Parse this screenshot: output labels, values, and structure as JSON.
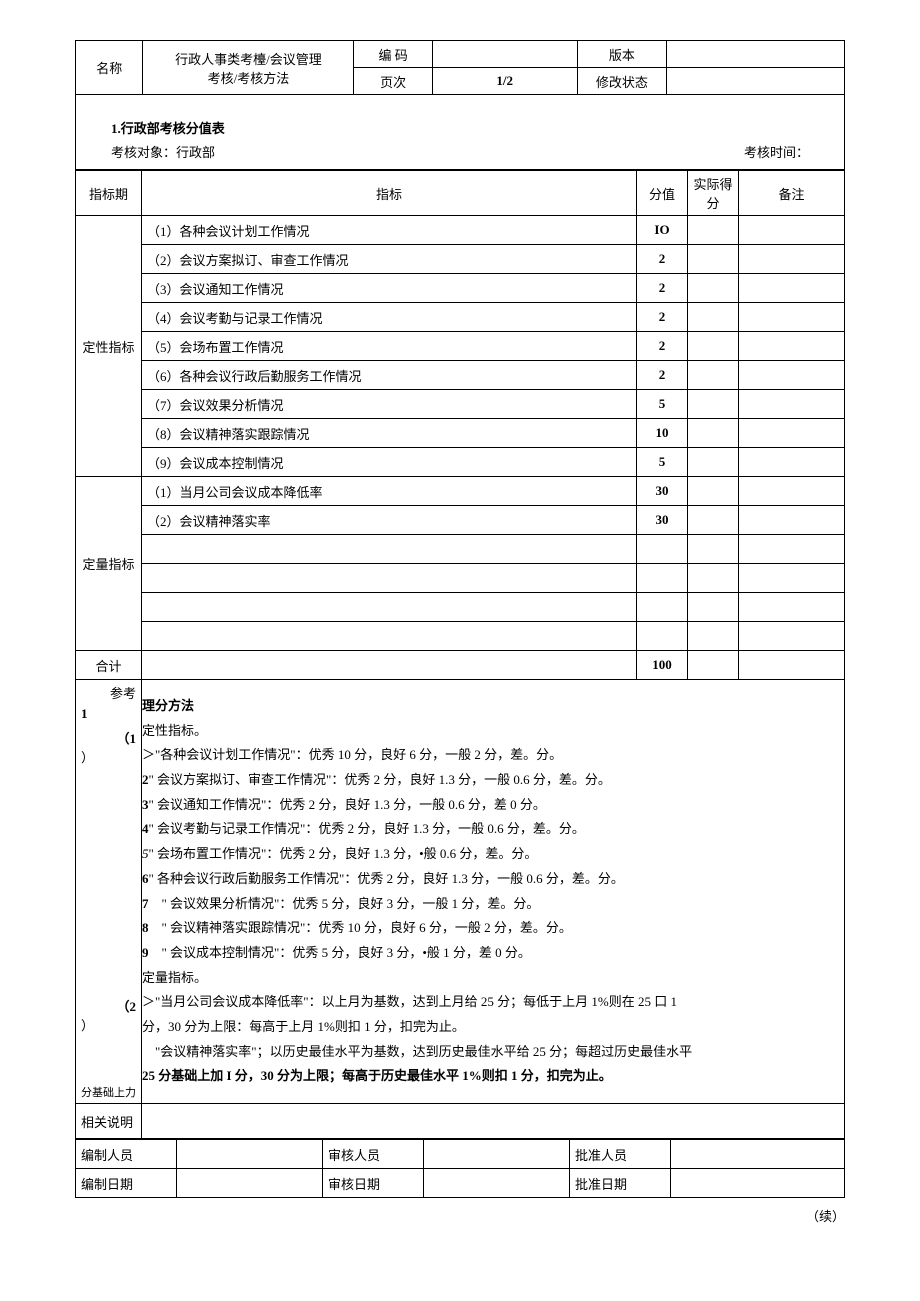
{
  "header": {
    "name_label": "名称",
    "doc_name_line1": "行政人事类考檯/会议管理",
    "doc_name_line2": "考核/考核方法",
    "code_label": "编 码",
    "code_value": "",
    "version_label": "版本",
    "version_value": "",
    "page_label": "页次",
    "page_value": "1/2",
    "mod_label": "修改状态",
    "mod_value": ""
  },
  "section": {
    "title": "1.行政部考核分值表",
    "target": "考核对象：行政部",
    "time": "考核时间："
  },
  "table_head": {
    "period": "指标期",
    "indicator": "指标",
    "score": "分值",
    "actual": "实际得分",
    "remark": "备注"
  },
  "qual_label": "定性指标",
  "qual_items": [
    {
      "no": "（1）",
      "text": "各种会议计划工作情况",
      "score": "IO"
    },
    {
      "no": "（2）",
      "text": "会议方案拟订、审查工作情况",
      "score": "2"
    },
    {
      "no": "（3）",
      "text": "会议通知工作情况",
      "score": "2"
    },
    {
      "no": "（4）",
      "text": "会议考勤与记录工作情况",
      "score": "2"
    },
    {
      "no": "（5）",
      "text": "会场布置工作情况",
      "score": "2"
    },
    {
      "no": "（6）",
      "text": "各种会议行政后勤服务工作情况",
      "score": "2"
    },
    {
      "no": "（7）",
      "text": "会议效果分析情况",
      "score": "5"
    },
    {
      "no": "（8）",
      "text": "会议精神落实跟踪情况",
      "score": "10"
    },
    {
      "no": "（9）",
      "text": "会议成本控制情况",
      "score": "5"
    }
  ],
  "quant_label": "定量指标",
  "quant_items": [
    {
      "no": "（1）",
      "text": "当月公司会议成本降低率",
      "score": "30"
    },
    {
      "no": "（2）",
      "text": "会议精神落实率",
      "score": "30"
    }
  ],
  "total_label": "合计",
  "total_score": "100",
  "ref_label": "参考",
  "basis_label": "分基础上力",
  "method": {
    "title": "理分方法",
    "m1": "（1",
    "m1b": "）",
    "qual_head": "定性指标。",
    "lines": [
      {
        "n": "",
        "t": "＞\"各种会议计划工作情况\"：优秀 10 分，良好 6 分，一般 2 分，差。分。"
      },
      {
        "n": "2",
        "t": "\" 会议方案拟订、审查工作情况\"：优秀 2 分，良好 1.3 分，一般 0.6 分，差。分。"
      },
      {
        "n": "3",
        "t": "\" 会议通知工作情况\"：优秀 2 分，良好 1.3 分，一般 0.6 分，差 0 分。"
      },
      {
        "n": "4",
        "t": "\" 会议考勤与记录工作情况\"：优秀 2 分，良好 1.3 分，一般 0.6 分，差。分。"
      },
      {
        "n": "5",
        "t": "\" 会场布置工作情况\"：优秀 2 分，良好 1.3 分，•般 0.6 分，差。分。"
      },
      {
        "n": "6",
        "t": "\" 各种会议行政后勤服务工作情况\"：优秀 2 分，良好 1.3 分，一般 0.6 分，差。分。"
      },
      {
        "n": "7",
        "t": "　\" 会议效果分析情况\"：优秀 5 分，良好 3 分，一般 1 分，差。分。"
      },
      {
        "n": "8",
        "t": "　\" 会议精神落实跟踪情况\"：优秀 10 分，良好 6 分，一般 2 分，差。分。"
      },
      {
        "n": "9",
        "t": "　\" 会议成本控制情况\"：优秀 5 分，良好 3 分，•般 1 分，差 0 分。"
      }
    ],
    "m2": "（2",
    "m2b": "）",
    "quant_head": "定量指标。",
    "q1": "＞\"当月公司会议成本降低率\"：以上月为基数，达到上月给 25 分；每低于上月 1%则在 25 口 1",
    "q1b": "分，30 分为上限：每高于上月 1%则扣 1 分，扣完为止。",
    "q2": "　\"会议精神落实率\"；以历史最佳水平为基数，达到历史最佳水平给 25 分；每超过历史最佳水平",
    "q2b": "25 分基础上加 I 分，30 分为上限；每高于历史最佳水平 1%则扣 1 分，扣完为止。"
  },
  "notes_label": "相关说明",
  "footer": {
    "compiler_lbl": "编制人员",
    "compiler": "",
    "reviewer_lbl": "审核人员",
    "reviewer": "",
    "approver_lbl": "批准人员",
    "approver": "",
    "compile_date_lbl": "编制日期",
    "compile_date": "",
    "review_date_lbl": "审核日期",
    "review_date": "",
    "approve_date_lbl": "批准日期",
    "approve_date": ""
  },
  "continued": "（续）"
}
